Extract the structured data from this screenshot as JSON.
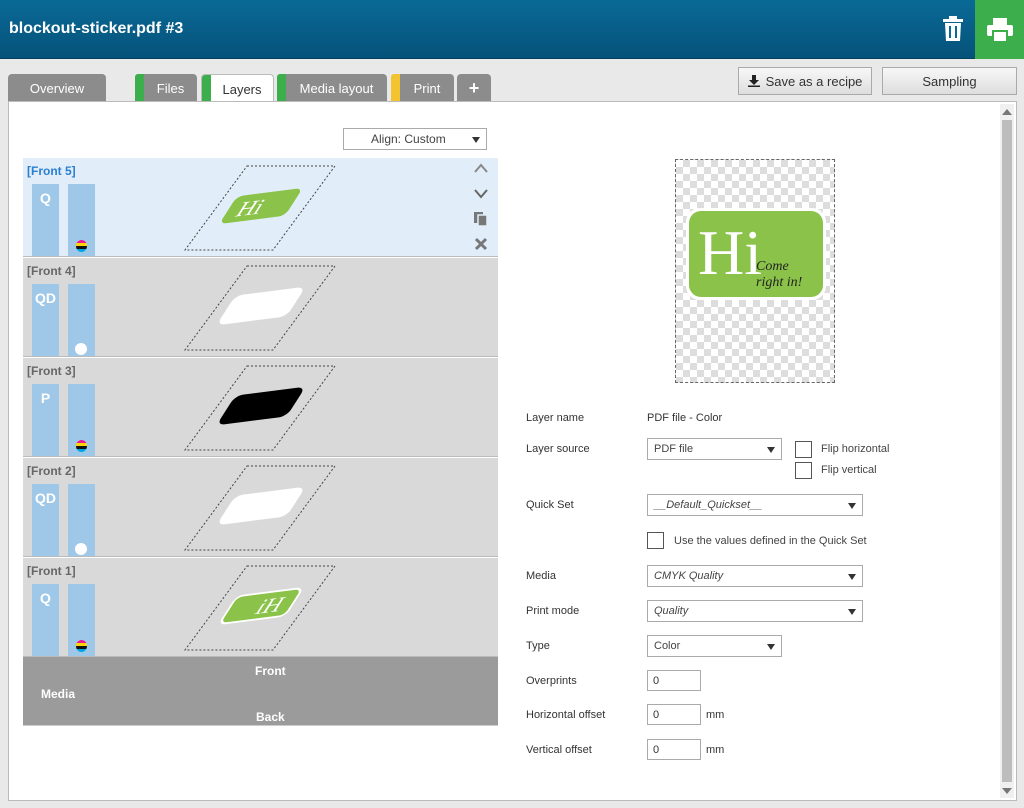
{
  "header": {
    "title": "blockout-sticker.pdf #3"
  },
  "tabs": [
    {
      "label": "Overview"
    },
    {
      "label": "Files"
    },
    {
      "label": "Layers"
    },
    {
      "label": "Media layout"
    },
    {
      "label": "Print"
    },
    {
      "label": "+"
    }
  ],
  "toolbar": {
    "save_recipe": "Save as a recipe",
    "sampling": "Sampling"
  },
  "align": {
    "value": "Align: Custom"
  },
  "layers": [
    {
      "label": "[Front 5]",
      "mode": "Q"
    },
    {
      "label": "[Front 4]",
      "mode": "QD"
    },
    {
      "label": "[Front 3]",
      "mode": "P"
    },
    {
      "label": "[Front 2]",
      "mode": "QD"
    },
    {
      "label": "[Front 1]",
      "mode": "Q"
    }
  ],
  "preview_art": {
    "big": "Hi",
    "line1": "Come",
    "line2": "right in!"
  },
  "media": {
    "label": "Media",
    "front": "Front",
    "back": "Back"
  },
  "form": {
    "layer_name_label": "Layer name",
    "layer_name_value": "PDF file - Color",
    "layer_source_label": "Layer source",
    "layer_source_value": "PDF file",
    "flip_horizontal": "Flip horizontal",
    "flip_vertical": "Flip vertical",
    "quickset_label": "Quick Set",
    "quickset_value": "__Default_Quickset__",
    "use_values": "Use the values defined in the Quick Set",
    "media_label": "Media",
    "media_value": "CMYK Quality",
    "print_mode_label": "Print mode",
    "print_mode_value": "Quality",
    "type_label": "Type",
    "type_value": "Color",
    "overprints_label": "Overprints",
    "overprints_value": "0",
    "hoffset_label": "Horizontal offset",
    "hoffset_value": "0",
    "voffset_label": "Vertical offset",
    "voffset_value": "0",
    "unit": "mm"
  },
  "colors": {
    "header": "#05527a",
    "accent_green": "#3cae4c",
    "tab_yellow": "#f4c430",
    "sticker_green": "#8bc34a",
    "selected_row": "#e1edf8",
    "bar_blue": "#9fc7e8"
  }
}
